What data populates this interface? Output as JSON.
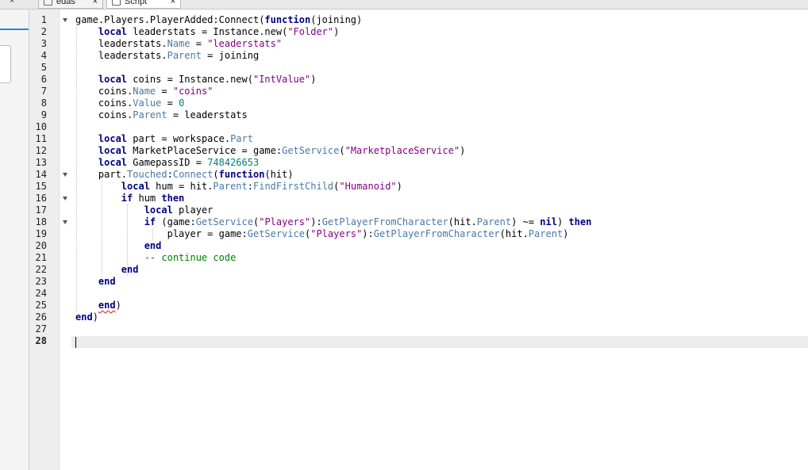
{
  "tabs": [
    {
      "label": "edas",
      "close": "×",
      "active": false
    },
    {
      "label": "Script",
      "close": "×",
      "active": true
    }
  ],
  "left_close": "×",
  "editor": {
    "current_line": 28,
    "lines": [
      [
        [
          "",
          "game.Players.PlayerAdded:Connect("
        ],
        [
          "kw",
          "function"
        ],
        [
          "",
          "(joining)"
        ]
      ],
      [
        [
          "",
          "    "
        ],
        [
          "kw",
          "local"
        ],
        [
          "",
          " leaderstats = Instance.new("
        ],
        [
          "str",
          "\"Folder\""
        ],
        [
          "",
          ")"
        ]
      ],
      [
        [
          "",
          "    leaderstats."
        ],
        [
          "prop",
          "Name"
        ],
        [
          "",
          " = "
        ],
        [
          "str",
          "\"leaderstats\""
        ]
      ],
      [
        [
          "",
          "    leaderstats."
        ],
        [
          "prop",
          "Parent"
        ],
        [
          "",
          " = joining"
        ]
      ],
      [],
      [
        [
          "",
          "    "
        ],
        [
          "kw",
          "local"
        ],
        [
          "",
          " coins = Instance.new("
        ],
        [
          "str",
          "\"IntValue\""
        ],
        [
          "",
          ")"
        ]
      ],
      [
        [
          "",
          "    coins."
        ],
        [
          "prop",
          "Name"
        ],
        [
          "",
          " = "
        ],
        [
          "str",
          "\"coins\""
        ]
      ],
      [
        [
          "",
          "    coins."
        ],
        [
          "prop",
          "Value"
        ],
        [
          "",
          " = "
        ],
        [
          "num",
          "0"
        ]
      ],
      [
        [
          "",
          "    coins."
        ],
        [
          "prop",
          "Parent"
        ],
        [
          "",
          " = leaderstats"
        ]
      ],
      [],
      [
        [
          "",
          "    "
        ],
        [
          "kw",
          "local"
        ],
        [
          "",
          " part = workspace."
        ],
        [
          "prop",
          "Part"
        ]
      ],
      [
        [
          "",
          "    "
        ],
        [
          "kw",
          "local"
        ],
        [
          "",
          " MarketPlaceService = game:"
        ],
        [
          "prop",
          "GetService"
        ],
        [
          "",
          "("
        ],
        [
          "str",
          "\"MarketplaceService\""
        ],
        [
          "",
          ")"
        ]
      ],
      [
        [
          "",
          "    "
        ],
        [
          "kw",
          "local"
        ],
        [
          "",
          " GamepassID = "
        ],
        [
          "num",
          "748426653"
        ]
      ],
      [
        [
          "",
          "    part."
        ],
        [
          "prop",
          "Touched"
        ],
        [
          "",
          ":"
        ],
        [
          "prop",
          "Connect"
        ],
        [
          "",
          "("
        ],
        [
          "kw",
          "function"
        ],
        [
          "",
          "(hit)"
        ]
      ],
      [
        [
          "",
          "        "
        ],
        [
          "kw",
          "local"
        ],
        [
          "",
          " hum = hit."
        ],
        [
          "prop",
          "Parent"
        ],
        [
          "",
          ":"
        ],
        [
          "prop",
          "FindFirstChild"
        ],
        [
          "",
          "("
        ],
        [
          "str",
          "\"Humanoid\""
        ],
        [
          "",
          ")"
        ]
      ],
      [
        [
          "",
          "        "
        ],
        [
          "kw",
          "if"
        ],
        [
          "",
          " hum "
        ],
        [
          "kw",
          "then"
        ]
      ],
      [
        [
          "",
          "            "
        ],
        [
          "kw",
          "local"
        ],
        [
          "",
          " player"
        ]
      ],
      [
        [
          "",
          "            "
        ],
        [
          "kw",
          "if"
        ],
        [
          "",
          " (game:"
        ],
        [
          "prop",
          "GetService"
        ],
        [
          "",
          "("
        ],
        [
          "str",
          "\"Players\""
        ],
        [
          "",
          "):"
        ],
        [
          "prop",
          "GetPlayerFromCharacter"
        ],
        [
          "",
          "(hit."
        ],
        [
          "prop",
          "Parent"
        ],
        [
          "",
          ") ~= "
        ],
        [
          "kw",
          "nil"
        ],
        [
          "",
          ") "
        ],
        [
          "kw",
          "then"
        ]
      ],
      [
        [
          "",
          "                player = game:"
        ],
        [
          "prop",
          "GetService"
        ],
        [
          "",
          "("
        ],
        [
          "str",
          "\"Players\""
        ],
        [
          "",
          "):"
        ],
        [
          "prop",
          "GetPlayerFromCharacter"
        ],
        [
          "",
          "(hit."
        ],
        [
          "prop",
          "Parent"
        ],
        [
          "",
          ")"
        ]
      ],
      [
        [
          "",
          "            "
        ],
        [
          "kw",
          "end"
        ]
      ],
      [
        [
          "",
          "            "
        ],
        [
          "cm",
          "-- continue code"
        ]
      ],
      [
        [
          "",
          "        "
        ],
        [
          "kw",
          "end"
        ]
      ],
      [
        [
          "",
          "    "
        ],
        [
          "kw",
          "end"
        ]
      ],
      [],
      [
        [
          "",
          "    "
        ],
        [
          "kw",
          "end"
        ],
        [
          "",
          ")"
        ]
      ],
      [
        [
          "kw",
          "end"
        ],
        [
          "",
          ")"
        ]
      ],
      [],
      []
    ]
  }
}
